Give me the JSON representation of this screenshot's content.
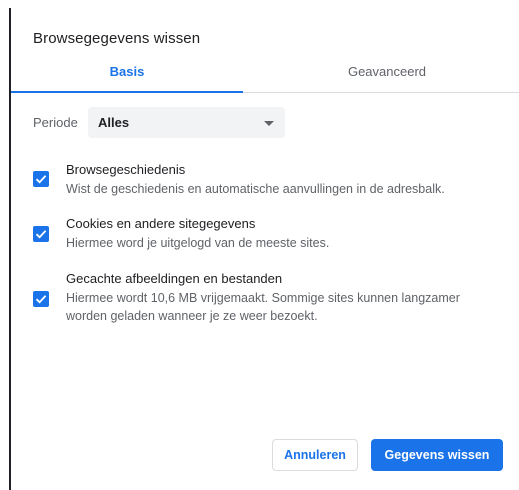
{
  "dialog": {
    "title": "Browsegegevens wissen"
  },
  "tabs": [
    {
      "label": "Basis",
      "active": true
    },
    {
      "label": "Geavanceerd",
      "active": false
    }
  ],
  "period": {
    "label": "Periode",
    "selected": "Alles",
    "icon": "chevron-down-icon"
  },
  "options": [
    {
      "title": "Browsegeschiedenis",
      "description": "Wist de geschiedenis en automatische aanvullingen in de adresbalk.",
      "checked": true
    },
    {
      "title": "Cookies en andere sitegegevens",
      "description": "Hiermee word je uitgelogd van de meeste sites.",
      "checked": true
    },
    {
      "title": "Gecachte afbeeldingen en bestanden",
      "description": "Hiermee wordt 10,6 MB vrijgemaakt. Sommige sites kunnen langzamer worden geladen wanneer je ze weer bezoekt.",
      "checked": true
    }
  ],
  "buttons": {
    "cancel": "Annuleren",
    "confirm": "Gegevens wissen"
  },
  "colors": {
    "accent": "#1a73e8",
    "text_primary": "#202124",
    "text_secondary": "#5f6368",
    "select_bg": "#f1f3f4"
  }
}
